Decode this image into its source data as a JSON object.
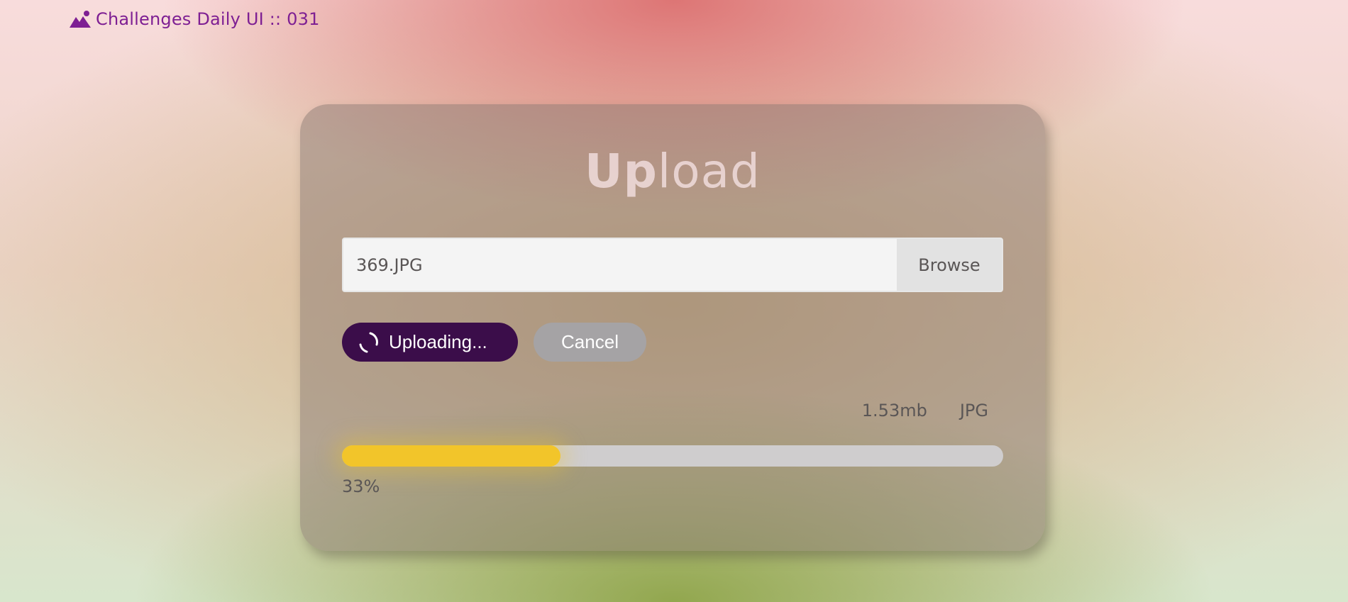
{
  "brand": {
    "icon": "image-mountain-icon",
    "label": "Challenges Daily UI :: 031",
    "color": "#7e1f93"
  },
  "card": {
    "title_bold": "Up",
    "title_light": "load",
    "file": {
      "value": "369.JPG",
      "browse_label": "Browse"
    },
    "upload_button": {
      "label": "Uploading...",
      "icon": "spinner-icon",
      "color": "#3b0d4a"
    },
    "cancel_button": {
      "label": "Cancel",
      "color": "#a5a3a5"
    },
    "meta": {
      "size": "1.53mb",
      "type": "JPG"
    },
    "progress": {
      "value": 0.33,
      "label": "33%",
      "fill_color": "#f2c52a",
      "track_color": "#cfcdce"
    }
  }
}
